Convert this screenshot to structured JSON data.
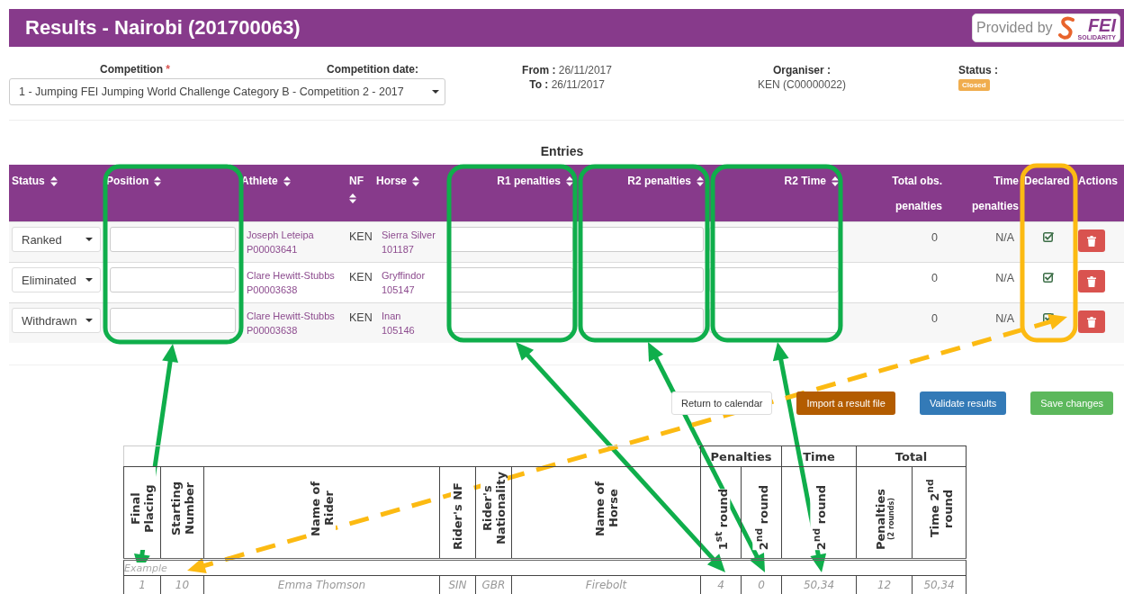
{
  "header": {
    "title": "Results - Nairobi (201700063)",
    "provider": {
      "label": "Provided by",
      "logo_text": "FEI",
      "logo_subtext": "SOLIDARITY"
    }
  },
  "competition": {
    "label": "Competition",
    "required_mark": "*",
    "date_label": "Competition date:",
    "value": "1 - Jumping FEI Jumping World Challenge Category B - Competition 2 - 2017"
  },
  "dates": {
    "from_label": "From :",
    "from": "26/11/2017",
    "to_label": "To :",
    "to": "26/11/2017"
  },
  "organiser": {
    "label": "Organiser :",
    "value": "KEN (C00000022)"
  },
  "status": {
    "label": "Status :",
    "badge": "Closed"
  },
  "entries": {
    "title": "Entries",
    "columns": [
      {
        "label": "Status",
        "sortable": true
      },
      {
        "label": "Position",
        "sortable": true
      },
      {
        "label": "Athlete",
        "sortable": true
      },
      {
        "label": "NF",
        "sortable": true
      },
      {
        "label": "Horse",
        "sortable": true
      },
      {
        "label": "R1 penalties",
        "sortable": true
      },
      {
        "label": "R2 penalties",
        "sortable": true
      },
      {
        "label": "R2 Time",
        "sortable": true
      },
      {
        "label": "Total obs. penalties",
        "sortable": false
      },
      {
        "label": "Time penalties",
        "sortable": false
      },
      {
        "label": "Declared",
        "sortable": false
      },
      {
        "label": "Actions",
        "sortable": false
      }
    ],
    "rows": [
      {
        "status": "Ranked",
        "athlete": "Joseph Leteipa",
        "athlete_id": "P00003641",
        "nf": "KEN",
        "horse": "Sierra Silver",
        "horse_id": "101187",
        "total_obs": "0",
        "time_penalties": "N/A",
        "declared": true
      },
      {
        "status": "Eliminated",
        "athlete": "Clare Hewitt-Stubbs",
        "athlete_id": "P00003638",
        "nf": "KEN",
        "horse": "Gryffindor",
        "horse_id": "105147",
        "total_obs": "0",
        "time_penalties": "N/A",
        "declared": true
      },
      {
        "status": "Withdrawn",
        "athlete": "Clare Hewitt-Stubbs",
        "athlete_id": "P00003638",
        "nf": "KEN",
        "horse": "Inan",
        "horse_id": "105146",
        "total_obs": "0",
        "time_penalties": "N/A",
        "declared": true
      }
    ]
  },
  "buttons": [
    {
      "label": "Return to calendar",
      "kind": "default"
    },
    {
      "label": "Import a result file",
      "kind": "warning"
    },
    {
      "label": "Validate results",
      "kind": "primary"
    },
    {
      "label": "Save changes",
      "kind": "success"
    }
  ],
  "form": {
    "groups": [
      {
        "label": "Penalties"
      },
      {
        "label": "Time"
      },
      {
        "label": "Total"
      }
    ],
    "columns": [
      {
        "label": "Final Placing"
      },
      {
        "label": "Starting Number"
      },
      {
        "label": "Name of Rider"
      },
      {
        "label": "Rider's NF"
      },
      {
        "label": "Rider's Nationality"
      },
      {
        "label": "Name of Horse"
      },
      {
        "label": "1$^{st}$ round"
      },
      {
        "label": "2$^{nd}$ round"
      },
      {
        "label": "2$^{nd}$ round"
      },
      {
        "label": "Penalties",
        "note": "(2 rounds)"
      },
      {
        "label": "Time 2$^{nd}$ round"
      }
    ],
    "example_label": "Example",
    "example_row": [
      "1",
      "10",
      "Emma Thomson",
      "SIN",
      "GBR",
      "Firebolt",
      "4",
      "0",
      "50,34",
      "12",
      "50,34"
    ]
  }
}
